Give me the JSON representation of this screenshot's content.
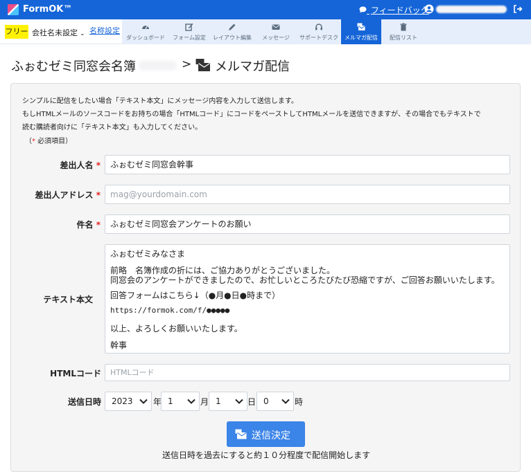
{
  "app": {
    "title": "FormOK™",
    "feedback_label": "フィードバック"
  },
  "subbar": {
    "plan_badge": "フリー",
    "company_label": "会社名未設定",
    "name_settings_label": "名称設定"
  },
  "nav": {
    "items": [
      {
        "label": "ダッシュボード",
        "icon": "gauge-icon"
      },
      {
        "label": "フォーム設定",
        "icon": "edit-icon"
      },
      {
        "label": "レイアウト編集",
        "icon": "layout-icon"
      },
      {
        "label": "メッセージ",
        "icon": "envelope-icon"
      },
      {
        "label": "サポートデスク",
        "icon": "headset-icon"
      },
      {
        "label": "メルマガ配信",
        "icon": "mail-bulk-icon",
        "active": true
      },
      {
        "label": "配信リスト",
        "icon": "trash-icon"
      }
    ]
  },
  "breadcrumb": {
    "root": "ふぉむゼミ同窓会名簿",
    "separator": ">",
    "current": "メルマガ配信"
  },
  "description": {
    "line1": "シンプルに配信をしたい場合「テキスト本文」にメッセージ内容を入力して送信します。",
    "line2": "もしHTMLメールのソースコードをお持ちの場合「HTMLコード」にコードをペーストしてHTMLメールを送信できますが、その場合でもテキストで",
    "line3": "読む購読者向けに「テキスト本文」も入力してください。",
    "required_note_prefix": "（",
    "required_note_star": "*",
    "required_note_suffix": " 必須項目）"
  },
  "form": {
    "sender_name_label": "差出人名",
    "sender_name_value": "ふぉむゼミ同窓会幹事",
    "sender_address_label": "差出人アドレス",
    "sender_address_placeholder": "mag@yourdomain.com",
    "subject_label": "件名",
    "subject_value": "ふぉむゼミ同窓会アンケートのお願い",
    "text_body_label": "テキスト本文",
    "text_body_lines": [
      "ふぉむゼミみなさま",
      "前略　名簿作成の折には、ご協力ありがとうございました。",
      "同窓会のアンケートができましたので、お忙しいところたびたび恐縮ですが、ご回答お願いいたします。",
      "回答フォームはこちら↓（●月●日●時まで）",
      "https://formok.com/f/●●●●●",
      "以上、よろしくお願いいたします。",
      "幹事"
    ],
    "html_code_label": "HTMLコード",
    "html_code_placeholder": "HTMLコード",
    "required_star": "*",
    "send_datetime_label": "送信日時",
    "year_value": "2023",
    "year_unit": "年",
    "month_value": "1",
    "month_unit": "月",
    "day_value": "1",
    "day_unit": "日",
    "hour_value": "0",
    "hour_unit": "時",
    "submit_label": "送信決定",
    "footer_note": "送信日時を過去にすると約１０分程度で配信開始します"
  },
  "colors": {
    "topbar": "#1565d8",
    "nav_bg": "#e6eefb",
    "nav_active": "#1565d8",
    "submit": "#3b84e8",
    "plan_badge": "#fff200",
    "required": "#e02424",
    "link": "#1565d8"
  }
}
